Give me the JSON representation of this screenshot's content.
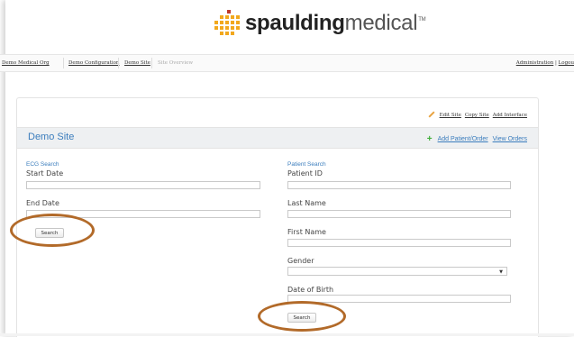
{
  "brand": {
    "name_bold": "spaulding",
    "name_light": "medical",
    "tm": "TM",
    "accent_color": "#f2a81d"
  },
  "breadcrumb": {
    "items": [
      "Demo Medical Org",
      "Demo Configuration",
      "Demo Site"
    ],
    "current": "Site Overview"
  },
  "admin_links": {
    "administration": "Administration",
    "logout": "Logou"
  },
  "panel_actions": {
    "edit_site": "Edit Site",
    "copy_site": "Copy Site",
    "add_interface": "Add Interface"
  },
  "site": {
    "title": "Demo Site",
    "add_patient_order": "Add Patient/Order",
    "view_orders": "View Orders"
  },
  "ecg_search": {
    "heading": "ECG Search",
    "start_date_label": "Start Date",
    "start_date_value": "",
    "end_date_label": "End Date",
    "end_date_value": "",
    "search_label": "Search"
  },
  "patient_search": {
    "heading": "Patient Search",
    "patient_id_label": "Patient ID",
    "last_name_label": "Last Name",
    "first_name_label": "First Name",
    "gender_label": "Gender",
    "gender_value": "",
    "dob_label": "Date of Birth",
    "search_label": "Search"
  },
  "colors": {
    "link_blue": "#3b7dbd",
    "plus_green": "#3fae3a",
    "highlight_ring": "#b26a29"
  }
}
